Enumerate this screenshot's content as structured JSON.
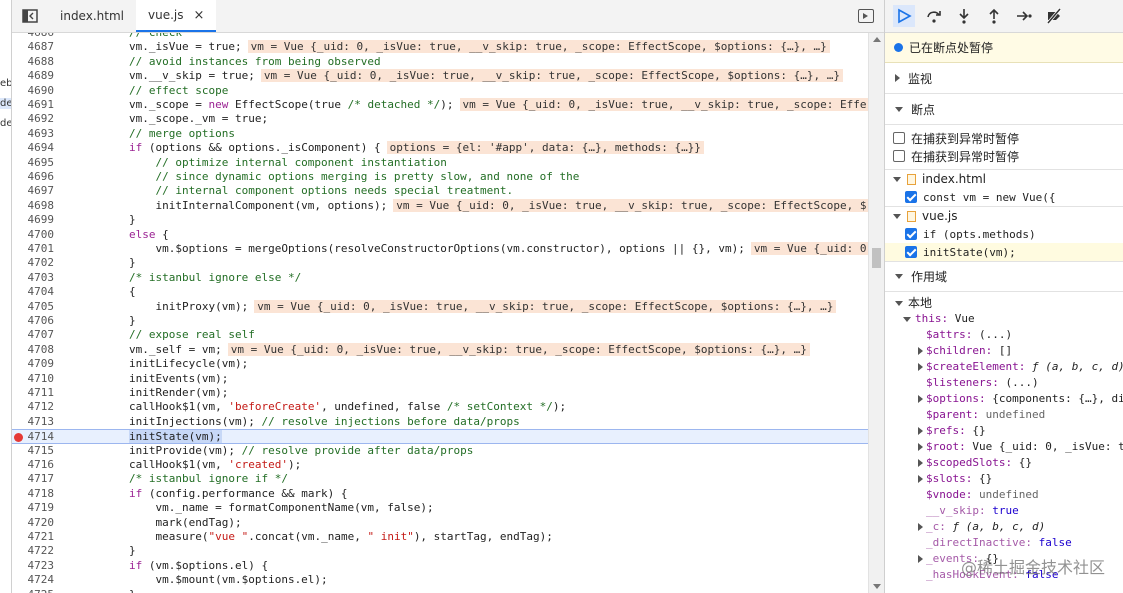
{
  "left_fragments": [
    "eb",
    "de",
    "de"
  ],
  "editor": {
    "tabs": [
      {
        "label": "index.html",
        "active": false
      },
      {
        "label": "vue.js",
        "active": true
      }
    ],
    "close_glyph": "×",
    "breakpoint_line": "4714"
  },
  "code_lines": [
    {
      "n": "4686",
      "s": [
        {
          "t": "// check",
          "c": "cm"
        }
      ]
    },
    {
      "n": "4687",
      "s": [
        {
          "t": "vm._isVue = true;"
        }
      ],
      "inl": "vm = Vue {_uid: 0, _isVue: true, __v_skip: true, _scope: EffectScope, $options: {…}, …}"
    },
    {
      "n": "4688",
      "s": [
        {
          "t": "// avoid instances from being observed",
          "c": "cm"
        }
      ]
    },
    {
      "n": "4689",
      "s": [
        {
          "t": "vm.__v_skip = true;"
        }
      ],
      "inl": "vm = Vue {_uid: 0, _isVue: true, __v_skip: true, _scope: EffectScope, $options: {…}, …}"
    },
    {
      "n": "4690",
      "s": [
        {
          "t": "// effect scope",
          "c": "cm"
        }
      ]
    },
    {
      "n": "4691",
      "s": [
        {
          "t": "vm._scope = "
        },
        {
          "t": "new",
          "c": "kw"
        },
        {
          "t": " EffectScope(true "
        },
        {
          "t": "/* detached */",
          "c": "cm"
        },
        {
          "t": ");"
        }
      ],
      "inl": "vm = Vue {_uid: 0, _isVue: true, __v_skip: true, _scope: Effe"
    },
    {
      "n": "4692",
      "s": [
        {
          "t": "vm._scope._vm = true;"
        }
      ]
    },
    {
      "n": "4693",
      "s": [
        {
          "t": "// merge options",
          "c": "cm"
        }
      ]
    },
    {
      "n": "4694",
      "s": [
        {
          "t": "if",
          "c": "kw"
        },
        {
          "t": " (options && options._isComponent) {"
        }
      ],
      "inl": "options = {el: '#app', data: {…}, methods: {…}}"
    },
    {
      "n": "4695",
      "s": [
        {
          "t": "    // optimize internal component instantiation",
          "c": "cm"
        }
      ]
    },
    {
      "n": "4696",
      "s": [
        {
          "t": "    // since dynamic options merging is pretty slow, and none of the",
          "c": "cm"
        }
      ]
    },
    {
      "n": "4697",
      "s": [
        {
          "t": "    // internal component options needs special treatment.",
          "c": "cm"
        }
      ]
    },
    {
      "n": "4698",
      "s": [
        {
          "t": "    initInternalComponent(vm, options);"
        }
      ],
      "inl": "vm = Vue {_uid: 0, _isVue: true, __v_skip: true, _scope: EffectScope, $"
    },
    {
      "n": "4699",
      "s": [
        {
          "t": "}"
        }
      ]
    },
    {
      "n": "4700",
      "s": [
        {
          "t": "else",
          "c": "kw"
        },
        {
          "t": " {"
        }
      ]
    },
    {
      "n": "4701",
      "s": [
        {
          "t": "    vm.$options = mergeOptions(resolveConstructorOptions(vm.constructor), options || {}, vm);"
        }
      ],
      "inl": "vm = Vue {_uid: 0"
    },
    {
      "n": "4702",
      "s": [
        {
          "t": "}"
        }
      ]
    },
    {
      "n": "4703",
      "s": [
        {
          "t": "/* istanbul ignore else */",
          "c": "cm"
        }
      ]
    },
    {
      "n": "4704",
      "s": [
        {
          "t": "{"
        }
      ]
    },
    {
      "n": "4705",
      "s": [
        {
          "t": "    initProxy(vm);"
        }
      ],
      "inl": "vm = Vue {_uid: 0, _isVue: true, __v_skip: true, _scope: EffectScope, $options: {…}, …}"
    },
    {
      "n": "4706",
      "s": [
        {
          "t": "}"
        }
      ]
    },
    {
      "n": "4707",
      "s": [
        {
          "t": "// expose real self",
          "c": "cm"
        }
      ]
    },
    {
      "n": "4708",
      "s": [
        {
          "t": "vm._self = vm;"
        }
      ],
      "inl": "vm = Vue {_uid: 0, _isVue: true, __v_skip: true, _scope: EffectScope, $options: {…}, …}"
    },
    {
      "n": "4709",
      "s": [
        {
          "t": "initLifecycle(vm);"
        }
      ]
    },
    {
      "n": "4710",
      "s": [
        {
          "t": "initEvents(vm);"
        }
      ]
    },
    {
      "n": "4711",
      "s": [
        {
          "t": "initRender(vm);"
        }
      ]
    },
    {
      "n": "4712",
      "s": [
        {
          "t": "callHook$1(vm, "
        },
        {
          "t": "'beforeCreate'",
          "c": "st"
        },
        {
          "t": ", undefined, false "
        },
        {
          "t": "/* setContext */",
          "c": "cm"
        },
        {
          "t": ");"
        }
      ]
    },
    {
      "n": "4713",
      "s": [
        {
          "t": "initInjections(vm); "
        },
        {
          "t": "// resolve injections before data/props",
          "c": "cm"
        }
      ]
    },
    {
      "n": "4714",
      "s": [
        {
          "t": "initState(vm);"
        }
      ]
    },
    {
      "n": "4715",
      "s": [
        {
          "t": "initProvide(vm); "
        },
        {
          "t": "// resolve provide after data/props",
          "c": "cm"
        }
      ]
    },
    {
      "n": "4716",
      "s": [
        {
          "t": "callHook$1(vm, "
        },
        {
          "t": "'created'",
          "c": "st"
        },
        {
          "t": ");"
        }
      ]
    },
    {
      "n": "4717",
      "s": [
        {
          "t": "/* istanbul ignore if */",
          "c": "cm"
        }
      ]
    },
    {
      "n": "4718",
      "s": [
        {
          "t": "if",
          "c": "kw"
        },
        {
          "t": " (config.performance && mark) {"
        }
      ]
    },
    {
      "n": "4719",
      "s": [
        {
          "t": "    vm._name = formatComponentName(vm, false);"
        }
      ]
    },
    {
      "n": "4720",
      "s": [
        {
          "t": "    mark(endTag);"
        }
      ]
    },
    {
      "n": "4721",
      "s": [
        {
          "t": "    measure("
        },
        {
          "t": "\"vue \"",
          "c": "st"
        },
        {
          "t": ".concat(vm._name, "
        },
        {
          "t": "\" init\"",
          "c": "st"
        },
        {
          "t": "), startTag, endTag);"
        }
      ]
    },
    {
      "n": "4722",
      "s": [
        {
          "t": "}"
        }
      ]
    },
    {
      "n": "4723",
      "s": [
        {
          "t": "if",
          "c": "kw"
        },
        {
          "t": " (vm.$options.el) {"
        }
      ]
    },
    {
      "n": "4724",
      "s": [
        {
          "t": "    vm.$mount(vm.$options.el);"
        }
      ]
    },
    {
      "n": "4725",
      "s": [
        {
          "t": "}"
        }
      ]
    }
  ],
  "debugger": {
    "toolbar_icons": [
      "resume-icon",
      "step-over-icon",
      "step-into-icon",
      "step-out-icon",
      "step-icon",
      "deactivate-breakpoints-icon"
    ],
    "paused_text": "已在断点处暂停",
    "watch_label": "监视",
    "breakpoints_label": "断点",
    "pause_uncaught": "在捕获到异常时暂停",
    "pause_caught": "在捕获到异常时暂停",
    "bp_files": [
      {
        "file": "index.html",
        "items": [
          {
            "code": "const vm = new Vue({",
            "highlight": false
          }
        ]
      },
      {
        "file": "vue.js",
        "items": [
          {
            "code": "if (opts.methods)",
            "highlight": false
          },
          {
            "code": "initState(vm);",
            "highlight": true
          }
        ]
      }
    ],
    "scope_label": "作用域",
    "local_label": "本地",
    "this_key": "this:",
    "this_val": "Vue",
    "scope_props": [
      {
        "k": "$attrs:",
        "v": "(...)",
        "tri": false
      },
      {
        "k": "$children:",
        "v": "[]",
        "tri": true
      },
      {
        "k": "$createElement:",
        "v": "ƒ (a, b, c, d)",
        "tri": true,
        "f": true
      },
      {
        "k": "$listeners:",
        "v": "(...)",
        "tri": false
      },
      {
        "k": "$options:",
        "v": "{components: {…}, di",
        "tri": true
      },
      {
        "k": "$parent:",
        "v": "undefined",
        "tri": false,
        "gray": true
      },
      {
        "k": "$refs:",
        "v": "{}",
        "tri": true
      },
      {
        "k": "$root:",
        "v": "Vue {_uid: 0, _isVue: t",
        "tri": true
      },
      {
        "k": "$scopedSlots:",
        "v": "{}",
        "tri": true
      },
      {
        "k": "$slots:",
        "v": "{}",
        "tri": true
      },
      {
        "k": "$vnode:",
        "v": "undefined",
        "tri": false,
        "gray": true
      },
      {
        "k": "__v_skip:",
        "v": "true",
        "tri": false,
        "num": true
      },
      {
        "k": "_c:",
        "v": "ƒ (a, b, c, d)",
        "tri": true,
        "f": true
      },
      {
        "k": "_directInactive:",
        "v": "false",
        "tri": false,
        "num": true
      },
      {
        "k": "_events:",
        "v": "{}",
        "tri": true
      },
      {
        "k": "_hasHookEvent:",
        "v": "false",
        "tri": false,
        "num": true
      }
    ]
  },
  "watermark": "@稀土掘金技术社区"
}
